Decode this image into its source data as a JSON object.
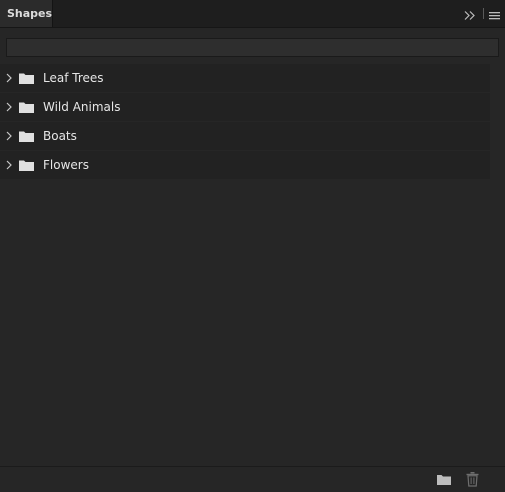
{
  "panel": {
    "tab_label": "Shapes"
  },
  "search": {
    "value": "",
    "placeholder": ""
  },
  "groups": [
    {
      "label": "Leaf Trees",
      "icon": "folder-icon",
      "expanded": false
    },
    {
      "label": "Wild Animals",
      "icon": "folder-icon",
      "expanded": false
    },
    {
      "label": "Boats",
      "icon": "folder-icon",
      "expanded": false
    },
    {
      "label": "Flowers",
      "icon": "folder-icon",
      "expanded": false
    }
  ],
  "toolbar": {
    "collapse_icon": "double-chevron-right-icon",
    "menu_icon": "hamburger-menu-icon",
    "new_group_icon": "folder-icon",
    "delete_icon": "trash-icon"
  },
  "colors": {
    "panel_bg": "#262626",
    "tab_bg": "#2b2b2b",
    "item_bg": "#222222",
    "text": "#e6e6e6",
    "icon": "#e0e0e0"
  }
}
